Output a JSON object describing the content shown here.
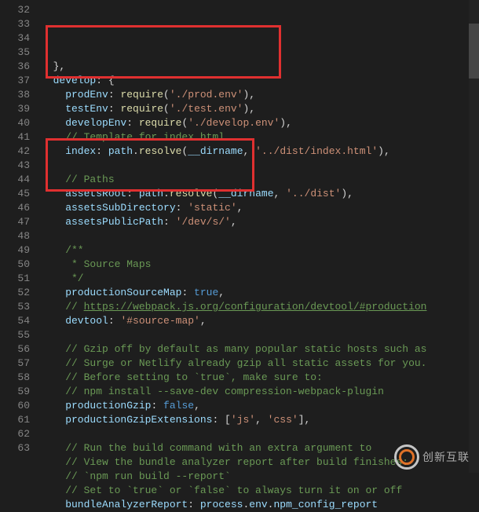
{
  "startLine": 32,
  "lines": [
    [
      [
        "punc",
        "  },"
      ]
    ],
    [
      [
        "prop",
        "  develop"
      ],
      [
        "punc",
        ": {"
      ]
    ],
    [
      [
        "prop",
        "    prodEnv"
      ],
      [
        "punc",
        ": "
      ],
      [
        "func",
        "require"
      ],
      [
        "punc",
        "("
      ],
      [
        "str",
        "'./prod.env'"
      ],
      [
        "punc",
        "),"
      ]
    ],
    [
      [
        "prop",
        "    testEnv"
      ],
      [
        "punc",
        ": "
      ],
      [
        "func",
        "require"
      ],
      [
        "punc",
        "("
      ],
      [
        "str",
        "'./test.env'"
      ],
      [
        "punc",
        "),"
      ]
    ],
    [
      [
        "prop",
        "    developEnv"
      ],
      [
        "punc",
        ": "
      ],
      [
        "func",
        "require"
      ],
      [
        "punc",
        "("
      ],
      [
        "str",
        "'./develop.env'"
      ],
      [
        "punc",
        "),"
      ]
    ],
    [
      [
        "comm",
        "    // Template for index.html"
      ]
    ],
    [
      [
        "prop",
        "    index"
      ],
      [
        "punc",
        ": "
      ],
      [
        "var",
        "path"
      ],
      [
        "punc",
        "."
      ],
      [
        "func",
        "resolve"
      ],
      [
        "punc",
        "("
      ],
      [
        "var",
        "__dirname"
      ],
      [
        "punc",
        ", "
      ],
      [
        "str",
        "'../dist/index.html'"
      ],
      [
        "punc",
        "),"
      ]
    ],
    [],
    [
      [
        "comm",
        "    // Paths"
      ]
    ],
    [
      [
        "prop",
        "    assetsRoot"
      ],
      [
        "punc",
        ": "
      ],
      [
        "var",
        "path"
      ],
      [
        "punc",
        "."
      ],
      [
        "func",
        "resolve"
      ],
      [
        "punc",
        "("
      ],
      [
        "var",
        "__dirname"
      ],
      [
        "punc",
        ", "
      ],
      [
        "str",
        "'../dist'"
      ],
      [
        "punc",
        "),"
      ]
    ],
    [
      [
        "prop",
        "    assetsSubDirectory"
      ],
      [
        "punc",
        ": "
      ],
      [
        "str",
        "'static'"
      ],
      [
        "punc",
        ","
      ]
    ],
    [
      [
        "prop",
        "    assetsPublicPath"
      ],
      [
        "punc",
        ": "
      ],
      [
        "str",
        "'/dev/s/'"
      ],
      [
        "punc",
        ","
      ]
    ],
    [],
    [
      [
        "comm",
        "    /**"
      ]
    ],
    [
      [
        "comm",
        "     * Source Maps"
      ]
    ],
    [
      [
        "comm",
        "     */"
      ]
    ],
    [
      [
        "prop",
        "    productionSourceMap"
      ],
      [
        "punc",
        ": "
      ],
      [
        "kw",
        "true"
      ],
      [
        "punc",
        ","
      ]
    ],
    [
      [
        "comm",
        "    // "
      ],
      [
        "link",
        "https://webpack.js.org/configuration/devtool/#production"
      ]
    ],
    [
      [
        "prop",
        "    devtool"
      ],
      [
        "punc",
        ": "
      ],
      [
        "str",
        "'#source-map'"
      ],
      [
        "punc",
        ","
      ]
    ],
    [],
    [
      [
        "comm",
        "    // Gzip off by default as many popular static hosts such as"
      ]
    ],
    [
      [
        "comm",
        "    // Surge or Netlify already gzip all static assets for you."
      ]
    ],
    [
      [
        "comm",
        "    // Before setting to `true`, make sure to:"
      ]
    ],
    [
      [
        "comm",
        "    // npm install --save-dev compression-webpack-plugin"
      ]
    ],
    [
      [
        "prop",
        "    productionGzip"
      ],
      [
        "punc",
        ": "
      ],
      [
        "kw",
        "false"
      ],
      [
        "punc",
        ","
      ]
    ],
    [
      [
        "prop",
        "    productionGzipExtensions"
      ],
      [
        "punc",
        ": ["
      ],
      [
        "str",
        "'js'"
      ],
      [
        "punc",
        ", "
      ],
      [
        "str",
        "'css'"
      ],
      [
        "punc",
        "],"
      ]
    ],
    [],
    [
      [
        "comm",
        "    // Run the build command with an extra argument to"
      ]
    ],
    [
      [
        "comm",
        "    // View the bundle analyzer report after build finishes:"
      ]
    ],
    [
      [
        "comm",
        "    // `npm run build --report`"
      ]
    ],
    [
      [
        "comm",
        "    // Set to `true` or `false` to always turn it on or off"
      ]
    ],
    [
      [
        "prop",
        "    bundleAnalyzerReport"
      ],
      [
        "punc",
        ": "
      ],
      [
        "var",
        "process"
      ],
      [
        "punc",
        "."
      ],
      [
        "var",
        "env"
      ],
      [
        "punc",
        "."
      ],
      [
        "var",
        "npm_config_report"
      ]
    ]
  ],
  "watermark": "创新互联"
}
